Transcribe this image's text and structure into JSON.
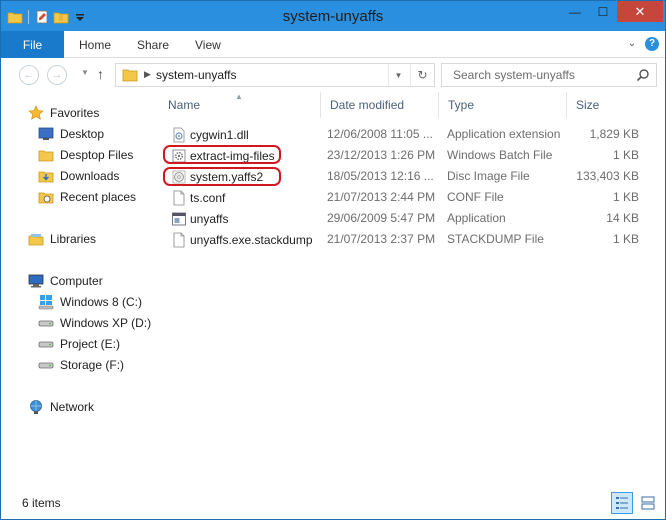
{
  "window": {
    "title": "system-unyaffs",
    "controls": {
      "minimize": "—",
      "maximize": "☐",
      "close": "✕"
    }
  },
  "ribbon": {
    "file_tab": "File",
    "tabs": [
      "Home",
      "Share",
      "View"
    ]
  },
  "address": {
    "path": "system-unyaffs"
  },
  "search": {
    "placeholder": "Search system-unyaffs"
  },
  "nav_pane": {
    "favorites_label": "Favorites",
    "favorites": [
      "Desktop",
      "Desptop Files",
      "Downloads",
      "Recent places"
    ],
    "libraries_label": "Libraries",
    "computer_label": "Computer",
    "drives": [
      "Windows 8 (C:)",
      "Windows XP (D:)",
      "Project (E:)",
      "Storage (F:)"
    ],
    "network_label": "Network"
  },
  "columns": {
    "name": "Name",
    "date": "Date modified",
    "type": "Type",
    "size": "Size"
  },
  "files": [
    {
      "name": "cygwin1.dll",
      "date": "12/06/2008 11:05 ...",
      "type": "Application extension",
      "size": "1,829 KB",
      "icon": "dll-file-icon",
      "highlighted": false
    },
    {
      "name": "extract-img-files",
      "date": "23/12/2013 1:26 PM",
      "type": "Windows Batch File",
      "size": "1 KB",
      "icon": "batch-file-icon",
      "highlighted": true
    },
    {
      "name": "system.yaffs2",
      "date": "18/05/2013 12:16 ...",
      "type": "Disc Image File",
      "size": "133,403 KB",
      "icon": "disc-image-icon",
      "highlighted": true
    },
    {
      "name": "ts.conf",
      "date": "21/07/2013 2:44 PM",
      "type": "CONF File",
      "size": "1 KB",
      "icon": "blank-file-icon",
      "highlighted": false
    },
    {
      "name": "unyaffs",
      "date": "29/06/2009 5:47 PM",
      "type": "Application",
      "size": "14 KB",
      "icon": "application-icon",
      "highlighted": false
    },
    {
      "name": "unyaffs.exe.stackdump",
      "date": "21/07/2013 2:37 PM",
      "type": "STACKDUMP File",
      "size": "1 KB",
      "icon": "blank-file-icon",
      "highlighted": false
    }
  ],
  "status": {
    "item_count": "6 items"
  },
  "colors": {
    "titlebar": "#2a8fde",
    "file_tab": "#1979ca",
    "close_button": "#c7463c",
    "highlight_ring": "#d0181e",
    "column_header_text": "#4c607a"
  }
}
